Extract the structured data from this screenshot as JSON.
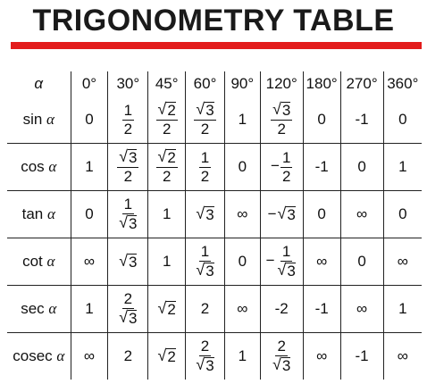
{
  "title": "TRIGONOMETRY TABLE",
  "colors": {
    "title_bar": "#e31b1b",
    "text": "#111111"
  },
  "table": {
    "header_label": "α",
    "angles": [
      "0°",
      "30°",
      "45°",
      "60°",
      "90°",
      "120°",
      "180°",
      "270°",
      "360°"
    ],
    "rows": [
      {
        "fn": "sin",
        "var": "α",
        "cells": [
          {
            "t": "plain",
            "v": "0"
          },
          {
            "t": "frac",
            "n": "1",
            "d": "2"
          },
          {
            "t": "frac",
            "n": "√2",
            "nr": true,
            "nv": "2",
            "d": "2"
          },
          {
            "t": "frac",
            "n": "√3",
            "nr": true,
            "nv": "3",
            "d": "2"
          },
          {
            "t": "plain",
            "v": "1"
          },
          {
            "t": "frac",
            "n": "√3",
            "nr": true,
            "nv": "3",
            "d": "2"
          },
          {
            "t": "plain",
            "v": "0"
          },
          {
            "t": "plain",
            "v": "-1"
          },
          {
            "t": "plain",
            "v": "0"
          }
        ]
      },
      {
        "fn": "cos",
        "var": "α",
        "cells": [
          {
            "t": "plain",
            "v": "1"
          },
          {
            "t": "frac",
            "n": "√3",
            "nr": true,
            "nv": "3",
            "d": "2"
          },
          {
            "t": "frac",
            "n": "√2",
            "nr": true,
            "nv": "2",
            "d": "2"
          },
          {
            "t": "frac",
            "n": "1",
            "d": "2"
          },
          {
            "t": "plain",
            "v": "0"
          },
          {
            "t": "frac",
            "neg": true,
            "n": "1",
            "d": "2"
          },
          {
            "t": "plain",
            "v": "-1"
          },
          {
            "t": "plain",
            "v": "0"
          },
          {
            "t": "plain",
            "v": "1"
          }
        ]
      },
      {
        "fn": "tan",
        "var": "α",
        "cells": [
          {
            "t": "plain",
            "v": "0"
          },
          {
            "t": "frac",
            "n": "1",
            "d": "√3",
            "dr": true,
            "dv": "3"
          },
          {
            "t": "plain",
            "v": "1"
          },
          {
            "t": "root",
            "v": "3"
          },
          {
            "t": "plain",
            "v": "∞"
          },
          {
            "t": "root",
            "v": "3",
            "neg": true
          },
          {
            "t": "plain",
            "v": "0"
          },
          {
            "t": "plain",
            "v": "∞"
          },
          {
            "t": "plain",
            "v": "0"
          }
        ]
      },
      {
        "fn": "cot",
        "var": "α",
        "cells": [
          {
            "t": "plain",
            "v": "∞"
          },
          {
            "t": "root",
            "v": "3"
          },
          {
            "t": "plain",
            "v": "1"
          },
          {
            "t": "frac",
            "n": "1",
            "d": "√3",
            "dr": true,
            "dv": "3"
          },
          {
            "t": "plain",
            "v": "0"
          },
          {
            "t": "frac",
            "neg": true,
            "n": "1",
            "d": "√3",
            "dr": true,
            "dv": "3"
          },
          {
            "t": "plain",
            "v": "∞"
          },
          {
            "t": "plain",
            "v": "0"
          },
          {
            "t": "plain",
            "v": "∞"
          }
        ]
      },
      {
        "fn": "sec",
        "var": "α",
        "cells": [
          {
            "t": "plain",
            "v": "1"
          },
          {
            "t": "frac",
            "n": "2",
            "d": "√3",
            "dr": true,
            "dv": "3"
          },
          {
            "t": "root",
            "v": "2"
          },
          {
            "t": "plain",
            "v": "2"
          },
          {
            "t": "plain",
            "v": "∞"
          },
          {
            "t": "plain",
            "v": "-2"
          },
          {
            "t": "plain",
            "v": "-1"
          },
          {
            "t": "plain",
            "v": "∞"
          },
          {
            "t": "plain",
            "v": "1"
          }
        ]
      },
      {
        "fn": "cosec",
        "var": "α",
        "cells": [
          {
            "t": "plain",
            "v": "∞"
          },
          {
            "t": "plain",
            "v": "2"
          },
          {
            "t": "root",
            "v": "2"
          },
          {
            "t": "frac",
            "n": "2",
            "d": "√3",
            "dr": true,
            "dv": "3"
          },
          {
            "t": "plain",
            "v": "1"
          },
          {
            "t": "frac",
            "n": "2",
            "d": "√3",
            "dr": true,
            "dv": "3"
          },
          {
            "t": "plain",
            "v": "∞"
          },
          {
            "t": "plain",
            "v": "-1"
          },
          {
            "t": "plain",
            "v": "∞"
          }
        ]
      }
    ]
  }
}
